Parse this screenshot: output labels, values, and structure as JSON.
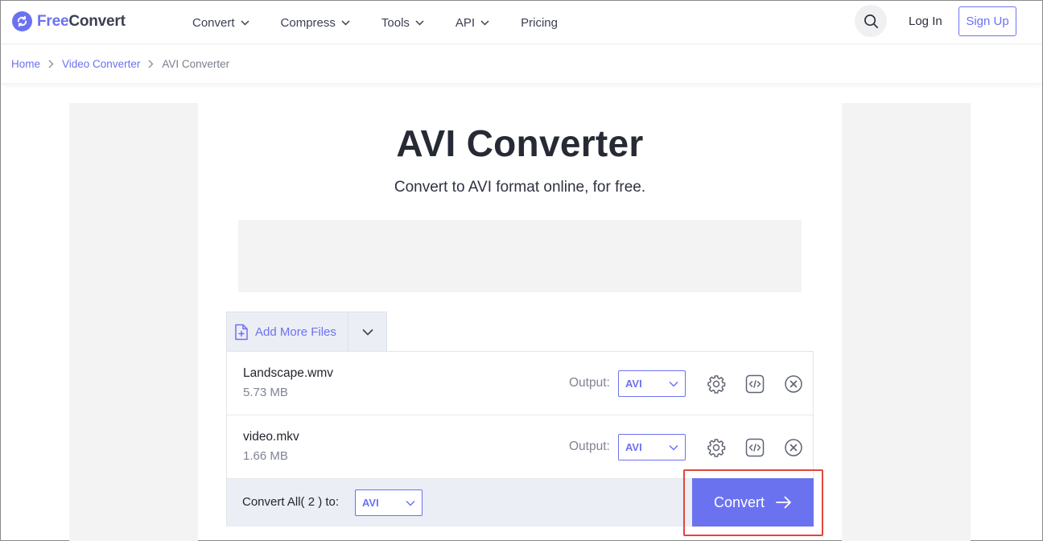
{
  "header": {
    "logo": {
      "part1": "Free",
      "part2": "Convert"
    },
    "nav": [
      {
        "label": "Convert",
        "has_dropdown": true
      },
      {
        "label": "Compress",
        "has_dropdown": true
      },
      {
        "label": "Tools",
        "has_dropdown": true
      },
      {
        "label": "API",
        "has_dropdown": true
      },
      {
        "label": "Pricing",
        "has_dropdown": false
      }
    ],
    "login_label": "Log In",
    "signup_label": "Sign Up"
  },
  "breadcrumb": [
    "Home",
    "Video Converter",
    "AVI Converter"
  ],
  "main": {
    "title": "AVI Converter",
    "subtitle": "Convert to AVI format online, for free.",
    "add_more_label": "Add More Files",
    "files": [
      {
        "name": "Landscape.wmv",
        "size": "5.73 MB",
        "output_label": "Output:",
        "output_format": "AVI"
      },
      {
        "name": "video.mkv",
        "size": "1.66 MB",
        "output_label": "Output:",
        "output_format": "AVI"
      }
    ],
    "convert_all_label": "Convert All( 2 ) to:",
    "convert_all_format": "AVI",
    "convert_button_label": "Convert"
  },
  "colors": {
    "accent": "#6b72f0",
    "highlight": "#e2453c",
    "panel": "#eceef5",
    "side_gray": "#f3f3f4"
  },
  "icons": [
    "logo-refresh-icon",
    "chevron-down-icon",
    "search-icon",
    "chevron-right-icon",
    "add-file-icon",
    "gear-icon",
    "embed-code-icon",
    "close-circle-icon",
    "arrow-right-icon"
  ]
}
